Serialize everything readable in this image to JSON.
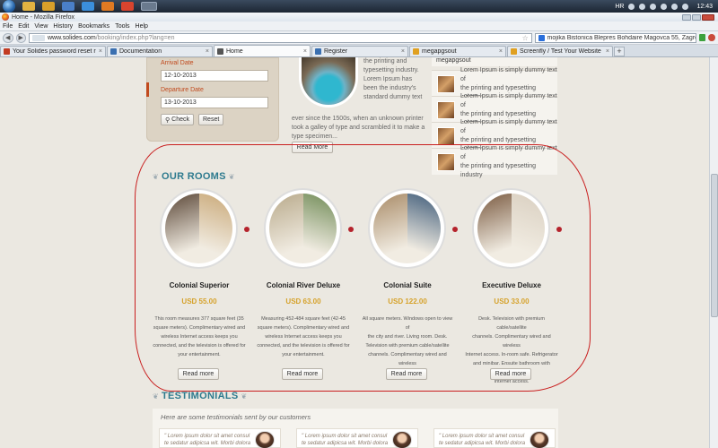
{
  "taskbar": {
    "tray_lang": "HR",
    "clock": "12:43"
  },
  "browser": {
    "window_title": "Home - Mozilla Firefox",
    "menu": [
      "File",
      "Edit",
      "View",
      "History",
      "Bookmarks",
      "Tools",
      "Help"
    ],
    "url_domain": "www.solides.com",
    "url_path": "/booking/index.php?lang=en",
    "search_text": "mojika Bistonica Blepres Bohdaire Magovca 55, Zagreb",
    "tabs": [
      {
        "label": "Your Solides password reset request ...",
        "color": "#c23b22"
      },
      {
        "label": "Documentation",
        "color": "#3a6fb0"
      },
      {
        "label": "Home",
        "color": "#555555",
        "active": true
      },
      {
        "label": "Register",
        "color": "#3a6fb0"
      },
      {
        "label": "megapgsout",
        "color": "#e0a020"
      },
      {
        "label": "Screenfly / Test Your Website at Diffe...",
        "color": "#e0a020"
      }
    ]
  },
  "booking": {
    "arrival_label": "Arrival Date",
    "arrival_value": "12-10-2013",
    "departure_label": "Departure Date",
    "departure_value": "13-10-2013",
    "check_label": "Check",
    "reset_label": "Reset"
  },
  "intro": {
    "text_right_lines": [
      "the printing and",
      "typesetting industry.",
      "Lorem Ipsum has",
      "been the industry's",
      "standard dummy text"
    ],
    "text_full_lines": [
      "ever since the 1500s, when an unknown printer",
      "took a galley of type and scrambled it to make a",
      "type specimen..."
    ],
    "read_more": "Read More"
  },
  "side_list": {
    "header": "megapgsout",
    "items": [
      {
        "line1": "Lorem Ipsum is simply dummy text of",
        "line2": "the printing and typesetting industry"
      },
      {
        "line1": "Lorem Ipsum is simply dummy text of",
        "line2": "the printing and typesetting industry"
      },
      {
        "line1": "Lorem Ipsum is simply dummy text of",
        "line2": "the printing and typesetting industry"
      },
      {
        "line1": "Lorem Ipsum is simply dummy text of",
        "line2": "the printing and typesetting industry"
      }
    ]
  },
  "rooms": {
    "title": "OUR ROOMS",
    "items": [
      {
        "name": "Colonial Superior",
        "price": "USD 55.00",
        "desc": [
          "This room measures 377 square feet (35",
          "square meters). Complimentary wired and",
          "wireless Internet access keeps you",
          "connected, and the television is offered for",
          "your entertainment."
        ],
        "read_more": "Read more",
        "colors": [
          "#5a4636",
          "#c9a877"
        ]
      },
      {
        "name": "Colonial River Deluxe",
        "price": "USD 63.00",
        "desc": [
          "Measuring 452-484 square feet (42-45",
          "square meters). Complimentary wired and",
          "wireless Internet access keeps you",
          "connected, and the television is offered for",
          "your entertainment."
        ],
        "read_more": "Read more",
        "colors": [
          "#b8a98a",
          "#6f8a55"
        ]
      },
      {
        "name": "Colonial Suite",
        "price": "USD 122.00",
        "desc": [
          "All square meters. Windows open to view of",
          "the city and river. Living room. Desk.",
          "Television with premium cable/satellite",
          "channels. Complimentary wired and wireless",
          "Internet access."
        ],
        "read_more": "Read more",
        "colors": [
          "#a88a66",
          "#3d5a78"
        ]
      },
      {
        "name": "Executive Deluxe",
        "price": "USD 33.00",
        "desc": [
          "Desk. Television with premium cable/satellite",
          "channels. Complimentary wired and wireless",
          "Internet access. In-room safe. Refrigerator",
          "and minibar. Ensuite bathroom with bathtub.",
          "Internet access."
        ],
        "read_more": "Read more",
        "colors": [
          "#7a5a40",
          "#d9cfc0"
        ]
      }
    ]
  },
  "testimonials": {
    "title": "TESTIMONIALS",
    "intro": "Here are some testimonials sent by our customers",
    "items": [
      {
        "quote": "\" Lorem ipsum dolor sit amet consul te sedatur adipicsa wit. Morbi dolora"
      },
      {
        "quote": "\" Lorem ipsum dolor sit amet consul te sedatur adipicsa wit. Morbi dolora"
      },
      {
        "quote": "\" Lorem ipsum dolor sit amet consul te sedatur adipicsa wit. Morbi dolora"
      }
    ]
  }
}
